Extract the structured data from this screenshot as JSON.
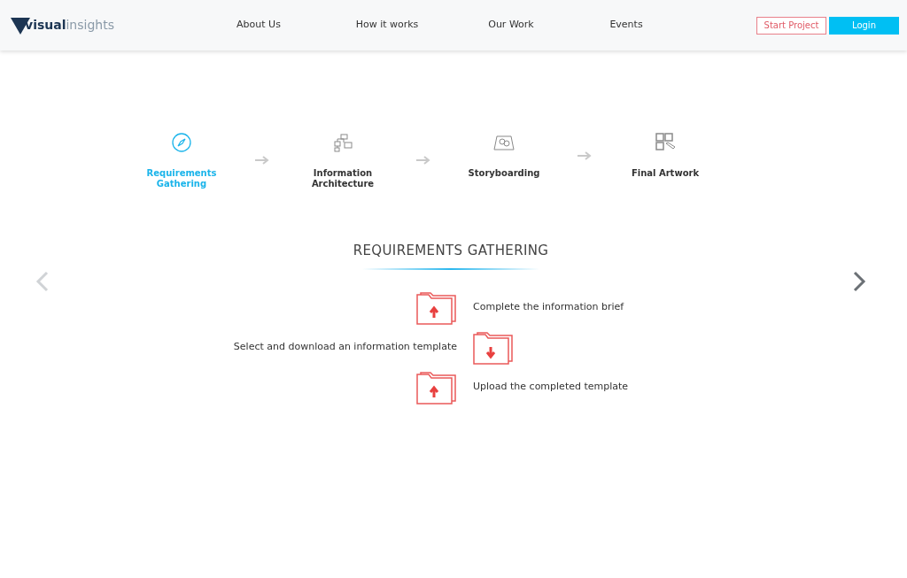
{
  "header": {
    "logo": {
      "bold": "visual",
      "light": "insights"
    },
    "nav": [
      "About Us",
      "How it works",
      "Our Work",
      "Events"
    ],
    "buttons": [
      {
        "label": "Start Project",
        "kind": "outline"
      },
      {
        "label": "Login",
        "kind": "solid"
      }
    ]
  },
  "steps": [
    {
      "label": "Requirements Gathering",
      "kind": "compass",
      "selected": true
    },
    {
      "label": "Information Architecture",
      "kind": "flowchart",
      "selected": false
    },
    {
      "label": "Storyboarding",
      "kind": "map",
      "selected": false
    },
    {
      "label": "Final Artwork",
      "kind": "grid",
      "selected": false
    }
  ],
  "section": {
    "title": "REQUIREMENTS GATHERING",
    "items": [
      {
        "text": "Complete the information brief",
        "kind": "upload"
      },
      {
        "text": "Select and download an information template",
        "kind": "download"
      },
      {
        "text": "Upload the completed template",
        "kind": "upload"
      }
    ]
  }
}
